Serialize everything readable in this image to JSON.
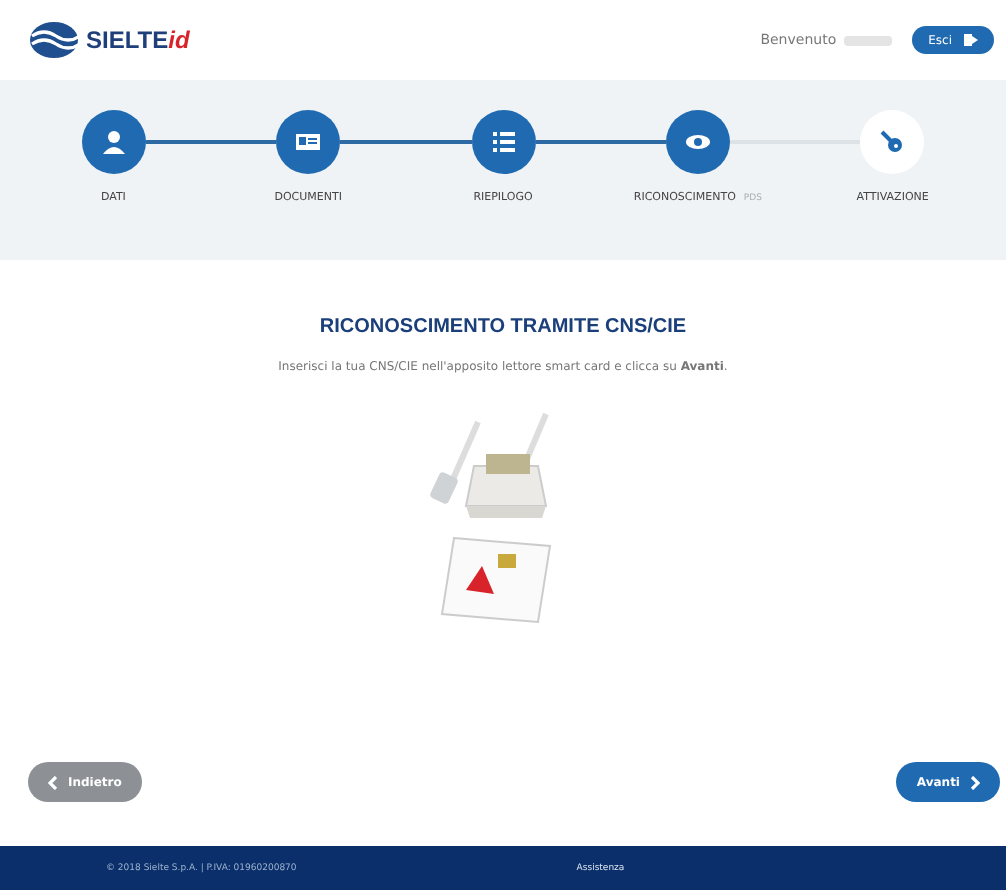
{
  "header": {
    "logo_text": "SIELTE",
    "logo_suffix": "id",
    "welcome": "Benvenuto",
    "logout_button": "Esci"
  },
  "steps": [
    {
      "label": "DATI",
      "kind": "person",
      "completed": true
    },
    {
      "label": "DOCUMENTI",
      "kind": "card",
      "completed": true
    },
    {
      "label": "RIEPILOGO",
      "kind": "list",
      "completed": true
    },
    {
      "label": "RICONOSCIMENTO",
      "kind": "eye",
      "completed": true,
      "note": "PDS"
    },
    {
      "label": "ATTIVAZIONE",
      "kind": "key",
      "completed": false
    }
  ],
  "content": {
    "title": "RICONOSCIMENTO TRAMITE CNS/CIE",
    "instruction": "Inserisci la tua CNS/CIE nell'apposito lettore smart card e clicca su **Avanti**."
  },
  "back_button": "Indietro",
  "next_button": "Avanti",
  "footer": {
    "copyright": "© 2018 Sielte S.p.A. | P.IVA: 01960200870",
    "link": "Assistenza"
  }
}
